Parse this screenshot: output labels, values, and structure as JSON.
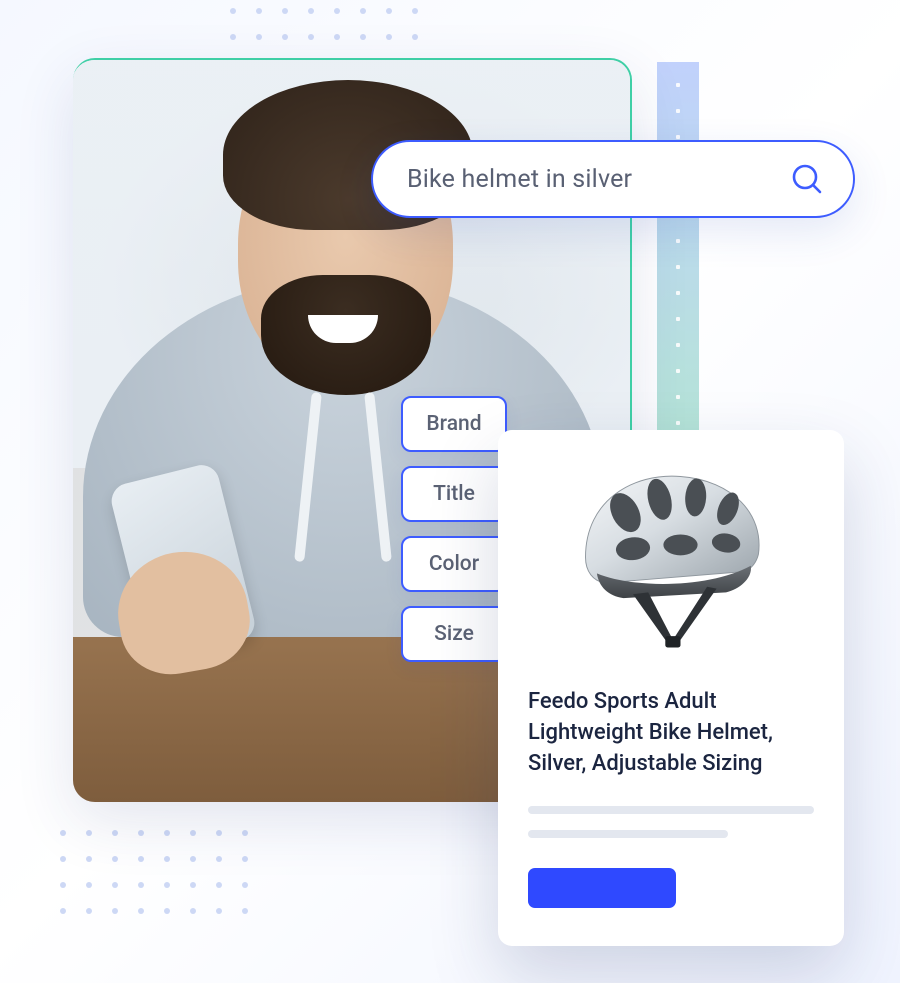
{
  "search": {
    "query": "Bike helmet in silver"
  },
  "attributes": [
    {
      "label": "Brand"
    },
    {
      "label": "Title"
    },
    {
      "label": "Color"
    },
    {
      "label": "Size"
    }
  ],
  "product": {
    "title": "Feedo Sports Adult Lightweight Bike Helmet, Silver, Adjustable Sizing",
    "image_alt": "Silver bike helmet"
  },
  "colors": {
    "accent": "#3d5cff",
    "cta": "#2f49ff"
  }
}
